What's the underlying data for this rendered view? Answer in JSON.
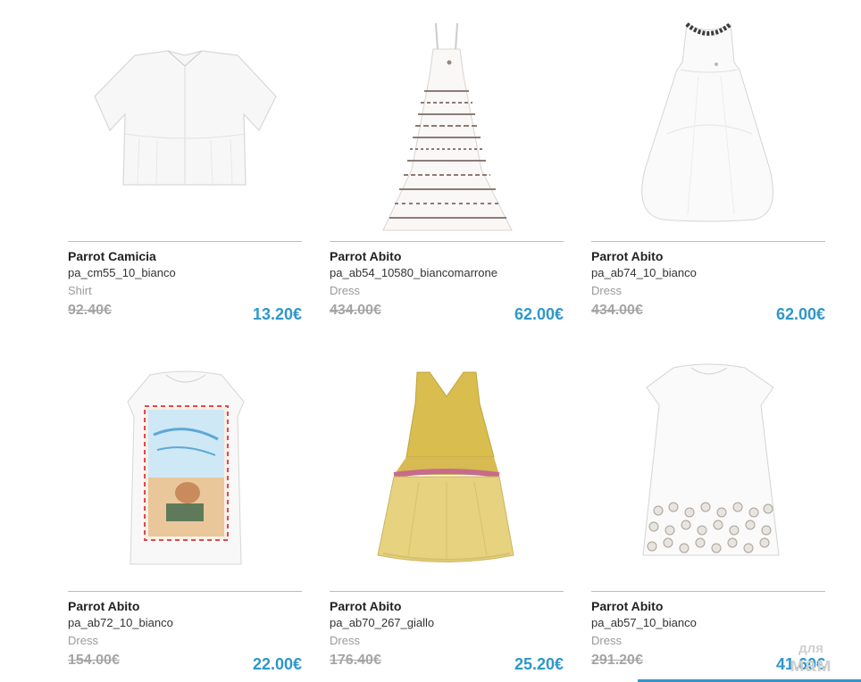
{
  "products": [
    {
      "name": "Parrot Camicia",
      "sku": "pa_cm55_10_bianco",
      "type": "Shirt",
      "old_price": "92.40€",
      "new_price": "13.20€",
      "image": "white-shirt"
    },
    {
      "name": "Parrot Abito",
      "sku": "pa_ab54_10580_biancomarrone",
      "type": "Dress",
      "old_price": "434.00€",
      "new_price": "62.00€",
      "image": "patterned-maxi-dress"
    },
    {
      "name": "Parrot Abito",
      "sku": "pa_ab74_10_bianco",
      "type": "Dress",
      "old_price": "434.00€",
      "new_price": "62.00€",
      "image": "white-hi-low-dress"
    },
    {
      "name": "Parrot Abito",
      "sku": "pa_ab72_10_bianco",
      "type": "Dress",
      "old_price": "154.00€",
      "new_price": "22.00€",
      "image": "printed-tshirt-dress"
    },
    {
      "name": "Parrot Abito",
      "sku": "pa_ab70_267_giallo",
      "type": "Dress",
      "old_price": "176.40€",
      "new_price": "25.20€",
      "image": "yellow-tulle-dress"
    },
    {
      "name": "Parrot Abito",
      "sku": "pa_ab57_10_bianco",
      "type": "Dress",
      "old_price": "291.20€",
      "new_price": "41.60€",
      "image": "white-embellished-dress"
    }
  ],
  "watermark": {
    "line1": "для",
    "line2": "мам"
  },
  "colors": {
    "price_accent": "#2f97c9",
    "old_price": "#a5a5a5",
    "divider": "#bdbdbd"
  }
}
